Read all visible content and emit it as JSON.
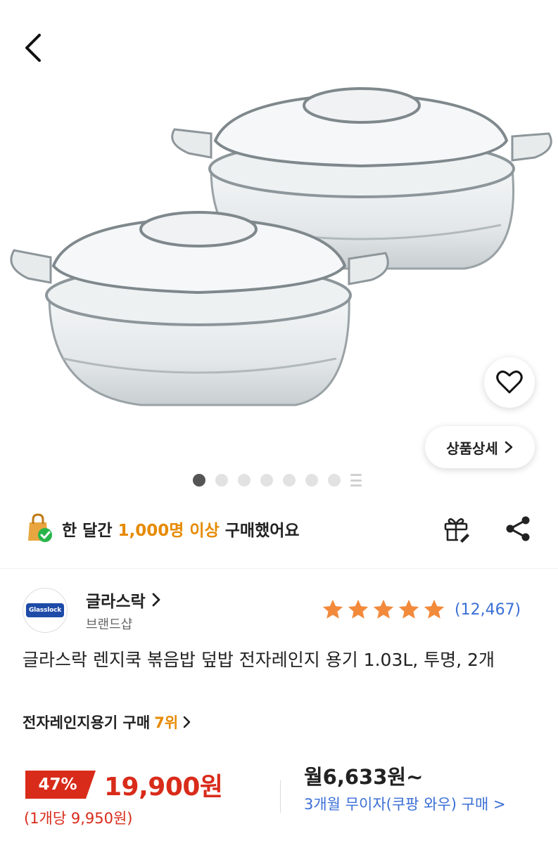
{
  "header": {
    "back_icon": "chevron-left-icon"
  },
  "gallery": {
    "image_alt": "glass casserole dishes with lids",
    "current_index": 1,
    "dot_count": 7,
    "more_icon": "more-images-icon",
    "wishlist_icon": "heart-icon",
    "detail_button_label": "상품상세",
    "detail_button_icon": "chevron-right-icon"
  },
  "sales": {
    "icon": "shopping-bag-check-icon",
    "prefix": "한 달간 ",
    "highlight": "1,000명 이상",
    "suffix": " 구매했어요",
    "highlight_color": "#e68a00"
  },
  "actions": {
    "gift_icon": "gift-icon",
    "share_icon": "share-icon"
  },
  "brand": {
    "logo_text": "Glasslock",
    "name": "글라스락",
    "subtitle": "브랜드샵"
  },
  "rating": {
    "stars": 5,
    "max_stars": 5,
    "count": "(12,467)",
    "star_color": "#f28a3c"
  },
  "product": {
    "title": "글라스락 렌지쿡 볶음밥 덮밥 전자레인지 용기 1.03L, 투명, 2개",
    "rank_label": "전자레인지용기 구매",
    "rank_value": "7위"
  },
  "price": {
    "discount": "47%",
    "sale_price": "19,900원",
    "unit_price": "(1개당 9,950원)",
    "monthly": "월6,633원~",
    "installment": "3개월 무이자(쿠팡 와우) 구매 >",
    "accent_color": "#d92b1a",
    "link_color": "#3b6fd6"
  }
}
